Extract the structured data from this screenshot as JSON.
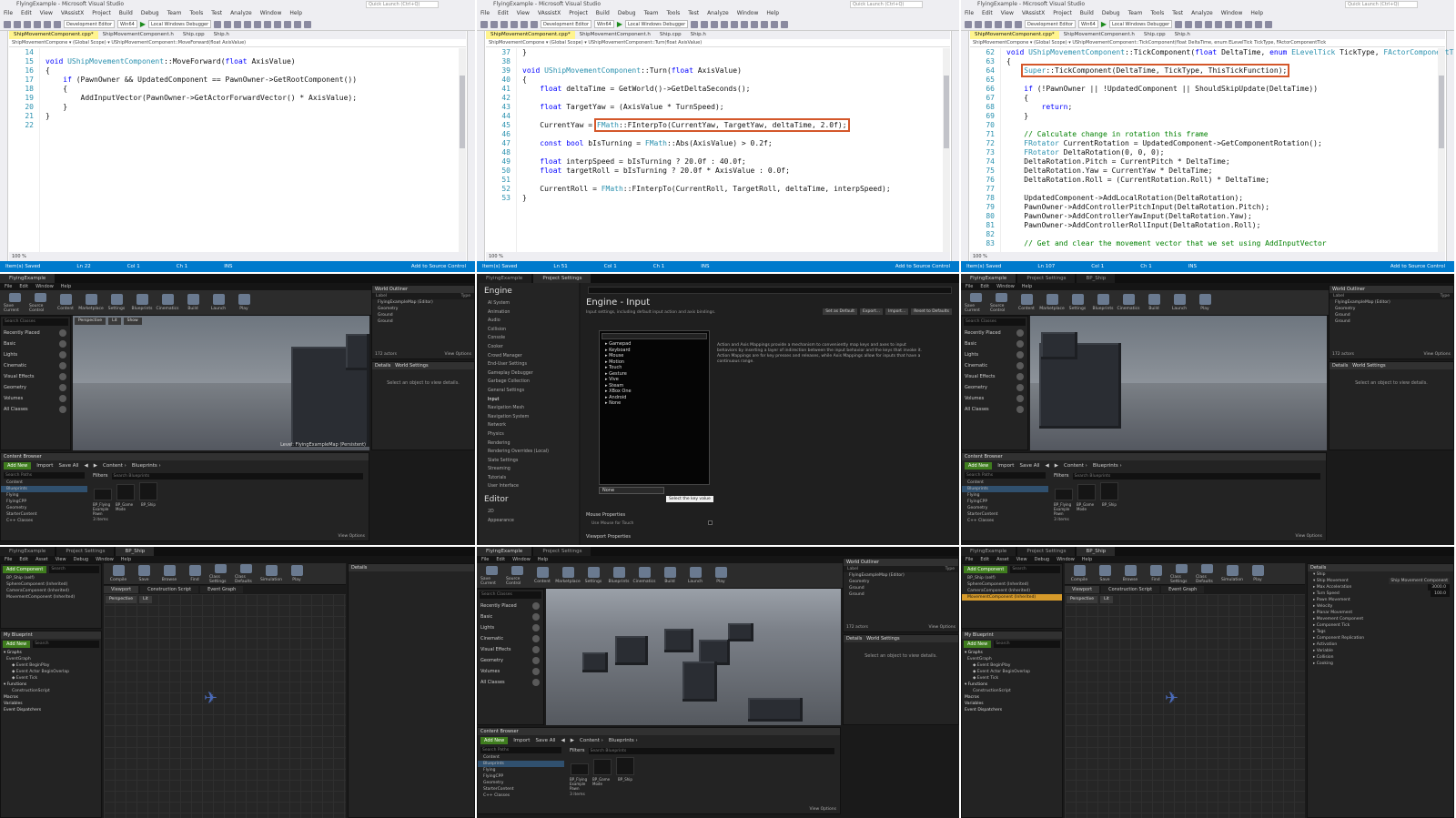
{
  "vs_common": {
    "window_title": "FlyingExample - Microsoft Visual Studio",
    "quick_launch": "Quick Launch (Ctrl+Q)",
    "menu": [
      "File",
      "Edit",
      "View",
      "VAssistX",
      "Project",
      "Build",
      "Debug",
      "Team",
      "Tools",
      "Test",
      "Analyze",
      "Window",
      "Help"
    ],
    "config": "Development Editor",
    "platform": "Win64",
    "debugger": "Local Windows Debugger",
    "zoom": "100 %",
    "status_ready": "Item(s) Saved",
    "add_source": "Add to Source Control"
  },
  "vs1": {
    "tabs": [
      "ShipMovementComponent.cpp*",
      "ShipMovementComponent.h",
      "Ship.cpp",
      "Ship.h"
    ],
    "nav": "ShipMovementCompone  ▾  (Global Scope)  ▾  UShipMovementComponent::MoveForward(float AxisValue)",
    "lines": [
      {
        "n": "14",
        "t": ""
      },
      {
        "n": "15",
        "t": "void UShipMovementComponent::MoveForward(float AxisValue)"
      },
      {
        "n": "16",
        "t": "{"
      },
      {
        "n": "17",
        "t": "    if (PawnOwner && UpdatedComponent == PawnOwner->GetRootComponent())"
      },
      {
        "n": "18",
        "t": "    {"
      },
      {
        "n": "19",
        "t": "        AddInputVector(PawnOwner->GetActorForwardVector() * AxisValue);"
      },
      {
        "n": "20",
        "t": "    }"
      },
      {
        "n": "21",
        "t": "}"
      },
      {
        "n": "22",
        "t": ""
      }
    ],
    "status": [
      "Ln 22",
      "Col 1",
      "Ch 1",
      "INS"
    ]
  },
  "vs2": {
    "tabs": [
      "ShipMovementComponent.cpp*",
      "ShipMovementComponent.h",
      "Ship.cpp",
      "Ship.h"
    ],
    "nav": "ShipMovementCompone  ▾  (Global Scope)  ▾  UShipMovementComponent::Turn(float AxisValue)",
    "lines": [
      {
        "n": "37",
        "t": "}"
      },
      {
        "n": "38",
        "t": ""
      },
      {
        "n": "39",
        "t": "void UShipMovementComponent::Turn(float AxisValue)"
      },
      {
        "n": "40",
        "t": "{"
      },
      {
        "n": "41",
        "t": "    float deltaTime = GetWorld()->GetDeltaSeconds();"
      },
      {
        "n": "42",
        "t": ""
      },
      {
        "n": "43",
        "t": "    float TargetYaw = (AxisValue * TurnSpeed);"
      },
      {
        "n": "44",
        "t": ""
      },
      {
        "n": "45",
        "t": "    CurrentYaw = ",
        "h": "FMath::FInterpTo(CurrentYaw, TargetYaw, deltaTime, 2.0f);"
      },
      {
        "n": "46",
        "t": ""
      },
      {
        "n": "47",
        "t": "    const bool bIsTurning = FMath::Abs(AxisValue) > 0.2f;"
      },
      {
        "n": "48",
        "t": ""
      },
      {
        "n": "49",
        "t": "    float interpSpeed = bIsTurning ? 20.0f : 40.0f;"
      },
      {
        "n": "50",
        "t": "    float targetRoll = bIsTurning ? 20.0f * AxisValue : 0.0f;"
      },
      {
        "n": "51",
        "t": ""
      },
      {
        "n": "52",
        "t": "    CurrentRoll = FMath::FInterpTo(CurrentRoll, TargetRoll, deltaTime, interpSpeed);"
      },
      {
        "n": "53",
        "t": "}"
      }
    ],
    "status": [
      "Ln 51",
      "Col 1",
      "Ch 1",
      "INS"
    ]
  },
  "vs3": {
    "tabs": [
      "ShipMovementComponent.cpp*",
      "ShipMovementComponent.h",
      "Ship.cpp",
      "Ship.h"
    ],
    "nav": "ShipMovementCompone  ▾  (Global Scope)  ▾  UShipMovementComponent::TickComponent(float DeltaTime, enum ELevelTick TickType, FActorComponentTick",
    "lines": [
      {
        "n": "62",
        "t": "void UShipMovementComponent::TickComponent(float DeltaTime, enum ELevelTick TickType, FActorComponentT"
      },
      {
        "n": "63",
        "t": "{"
      },
      {
        "n": "64",
        "t": "    ",
        "h": "Super::TickComponent(DeltaTime, TickType, ThisTickFunction);"
      },
      {
        "n": "65",
        "t": ""
      },
      {
        "n": "66",
        "t": "    if (!PawnOwner || !UpdatedComponent || ShouldSkipUpdate(DeltaTime))"
      },
      {
        "n": "67",
        "t": "    {"
      },
      {
        "n": "68",
        "t": "        return;"
      },
      {
        "n": "69",
        "t": "    }"
      },
      {
        "n": "70",
        "t": ""
      },
      {
        "n": "71",
        "t": "    // Calculate change in rotation this frame"
      },
      {
        "n": "72",
        "t": "    FRotator CurrentRotation = UpdatedComponent->GetComponentRotation();"
      },
      {
        "n": "73",
        "t": "    FRotator DeltaRotation(0, 0, 0);"
      },
      {
        "n": "74",
        "t": "    DeltaRotation.Pitch = CurrentPitch * DeltaTime;"
      },
      {
        "n": "75",
        "t": "    DeltaRotation.Yaw = CurrentYaw * DeltaTime;"
      },
      {
        "n": "76",
        "t": "    DeltaRotation.Roll = (CurrentRotation.Roll) * DeltaTime;"
      },
      {
        "n": "77",
        "t": ""
      },
      {
        "n": "78",
        "t": "    UpdatedComponent->AddLocalRotation(DeltaRotation);"
      },
      {
        "n": "79",
        "t": "    PawnOwner->AddControllerPitchInput(DeltaRotation.Pitch);"
      },
      {
        "n": "80",
        "t": "    PawnOwner->AddControllerYawInput(DeltaRotation.Yaw);"
      },
      {
        "n": "81",
        "t": "    PawnOwner->AddControllerRollInput(DeltaRotation.Roll);"
      },
      {
        "n": "82",
        "t": ""
      },
      {
        "n": "83",
        "t": "    // Get and clear the movement vector that we set using AddInputVector"
      }
    ],
    "status": [
      "Ln 107",
      "Col 1",
      "Ch 1",
      "INS"
    ]
  },
  "ue_common": {
    "project": "FlyingExample",
    "menu": [
      "File",
      "Edit",
      "Window",
      "Help"
    ],
    "bp_menu": [
      "File",
      "Edit",
      "Asset",
      "View",
      "Debug",
      "Window",
      "Help"
    ],
    "tools": [
      "Save Current",
      "Source Control",
      "Content",
      "Marketplace",
      "Settings",
      "Blueprints",
      "Cinematics",
      "Build",
      "Launch",
      "Play"
    ],
    "modes": [
      "Recently Placed",
      "Basic",
      "Lights",
      "Cinematic",
      "Visual Effects",
      "Geometry",
      "Volumes",
      "All Classes"
    ],
    "search_classes": "Search Classes",
    "viewport": [
      "Perspective",
      "Lit",
      "Show"
    ],
    "level_label": "Level: FlyingExampleMap (Persistent)",
    "outliner_title": "World Outliner",
    "outliner_cols": [
      "Label",
      "Type"
    ],
    "outliner_rows": [
      "FlyingExampleMap (Editor)",
      "Geometry",
      "Ground",
      "Ground"
    ],
    "actors": "172 actors",
    "view_options": "View Options",
    "details_title": "Details",
    "world_settings": "World Settings",
    "select_hint": "Select an object to view details.",
    "cb_title": "Content Browser",
    "add_new": "Add New",
    "import": "Import",
    "save_all": "Save All",
    "crumbs": [
      "Content",
      "Blueprints"
    ],
    "filters": "Filters",
    "search_paths": "Search Paths",
    "search_blueprints": "Search Blueprints",
    "tree": [
      "Content",
      "Blueprints",
      "Flying",
      "FlyingCPP",
      "Geometry",
      "StarterContent",
      "C++ Classes"
    ],
    "assets": [
      "BP_Flying Example Pawn",
      "BP_Game Mode",
      "BP_Ship"
    ],
    "items": "3 items"
  },
  "ue_settings": {
    "tabs": [
      "FlyingExample",
      "Project Settings"
    ],
    "engine": "Engine",
    "editor": "Editor",
    "nav": [
      "AI System",
      "Animation",
      "Audio",
      "Collision",
      "Console",
      "Cooker",
      "Crowd Manager",
      "End-User Settings",
      "Gameplay Debugger",
      "Garbage Collection",
      "General Settings",
      "Input",
      "Navigation Mesh",
      "Navigation System",
      "Network",
      "Physics",
      "Rendering",
      "Rendering Overrides (Local)",
      "Slate Settings",
      "Streaming",
      "Tutorials",
      "User Interface"
    ],
    "editor_nav": [
      "2D",
      "Appearance"
    ],
    "title": "Engine - Input",
    "subtitle": "Input settings, including default input action and axis bindings.",
    "buttons": [
      "Set as Default",
      "Export...",
      "Import...",
      "Reset to Defaults"
    ],
    "dropdown": [
      "Gamepad",
      "Keyboard",
      "Mouse",
      "Motion",
      "Touch",
      "Gesture",
      "Vive",
      "Steam",
      "XBox One",
      "Android",
      "None"
    ],
    "selected": "None",
    "tooltip": "Select the key value",
    "mouse_props": "Mouse Properties",
    "use_mouse": "Use Mouse for Touch",
    "viewport_props": "Viewport Properties",
    "desc": "Action and Axis Mappings provide a mechanism to conveniently map keys and axes to input behaviors by inserting a layer of indirection between the input behavior and the keys that invoke it. Action Mappings are for key presses and releases, while Axis Mappings allow for inputs that have a continuous range."
  },
  "ue_bp": {
    "tabs": [
      "FlyingExample",
      "Project Settings",
      "BP_Ship"
    ],
    "add_component": "Add Component",
    "search": "Search",
    "components_title": "Components",
    "components": [
      "BP_Ship (self)",
      "SphereComponent (Inherited)",
      "CameraComponent (Inherited)",
      "MovementComponent (Inherited)"
    ],
    "tools": [
      "Compile",
      "Save",
      "Browse",
      "Find",
      "Class Settings",
      "Class Defaults",
      "Simulation",
      "Play"
    ],
    "viewport_tabs": [
      "Viewport",
      "Construction Script",
      "Event Graph"
    ],
    "mybp_title": "My Blueprint",
    "graphs": "Graphs",
    "event_graph": "EventGraph",
    "events": [
      "Event BeginPlay",
      "Event Actor BeginOverlap",
      "Event Tick"
    ],
    "functions": "Functions",
    "construction": "ConstructionScript",
    "macros": "Macros",
    "variables": "Variables",
    "dispatchers": "Event Dispatchers",
    "details_rows": [
      "Ship",
      "Ship Movement",
      "Max Acceleration",
      "Turn Speed",
      "Pawn Movement",
      "Velocity",
      "Planar Movement",
      "Movement Component",
      "Component Tick",
      "Tags",
      "Component Replication",
      "Activation",
      "Variable",
      "Collision",
      "Cooking"
    ],
    "max_accel": "3000.0",
    "turn_speed": "100.0",
    "movement_value": "Ship Movement Component"
  },
  "colors": {
    "vs_status": "#007acc",
    "ue_bg": "#1a1a1a",
    "highlight": "#d4572a",
    "selection": "#d69a2a"
  }
}
